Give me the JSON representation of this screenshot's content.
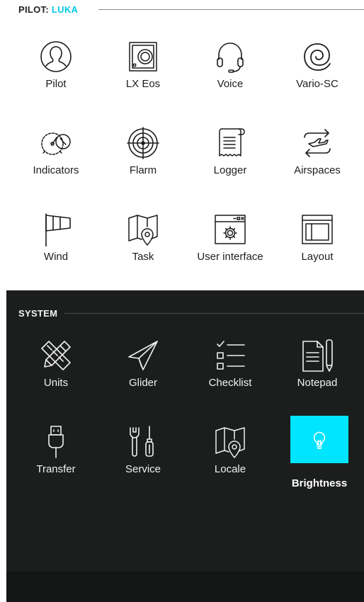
{
  "pilot_section": {
    "header_prefix": "PILOT: ",
    "pilot_name": "LUKA",
    "items": [
      {
        "label": "Pilot",
        "icon": "pilot-avatar-icon"
      },
      {
        "label": "LX Eos",
        "icon": "lx-eos-device-icon"
      },
      {
        "label": "Voice",
        "icon": "headset-icon"
      },
      {
        "label": "Vario-SC",
        "icon": "spiral-icon"
      },
      {
        "label": "Indicators",
        "icon": "gauges-icon"
      },
      {
        "label": "Flarm",
        "icon": "target-icon"
      },
      {
        "label": "Logger",
        "icon": "scroll-log-icon"
      },
      {
        "label": "Airspaces",
        "icon": "airspace-arrows-plane-icon"
      },
      {
        "label": "Wind",
        "icon": "windsock-icon"
      },
      {
        "label": "Task",
        "icon": "task-map-pin-icon"
      },
      {
        "label": "User interface",
        "icon": "window-gear-icon"
      },
      {
        "label": "Layout",
        "icon": "layout-window-icon"
      }
    ]
  },
  "system_section": {
    "header": "SYSTEM",
    "items": [
      {
        "label": "Units",
        "icon": "ruler-pencil-icon"
      },
      {
        "label": "Glider",
        "icon": "paper-plane-icon"
      },
      {
        "label": "Checklist",
        "icon": "checklist-icon"
      },
      {
        "label": "Notepad",
        "icon": "notepad-pencil-icon"
      },
      {
        "label": "Transfer",
        "icon": "usb-plug-icon"
      },
      {
        "label": "Service",
        "icon": "wrench-screwdriver-icon"
      },
      {
        "label": "Locale",
        "icon": "locale-map-pin-icon"
      },
      {
        "label": "Brightness",
        "icon": "lightbulb-icon",
        "selected": true
      }
    ]
  },
  "colors": {
    "accent": "#00e5ff",
    "pilot_name": "#00c8e6",
    "system_bg": "#1b1e1d",
    "light_bg": "#ffffff"
  }
}
